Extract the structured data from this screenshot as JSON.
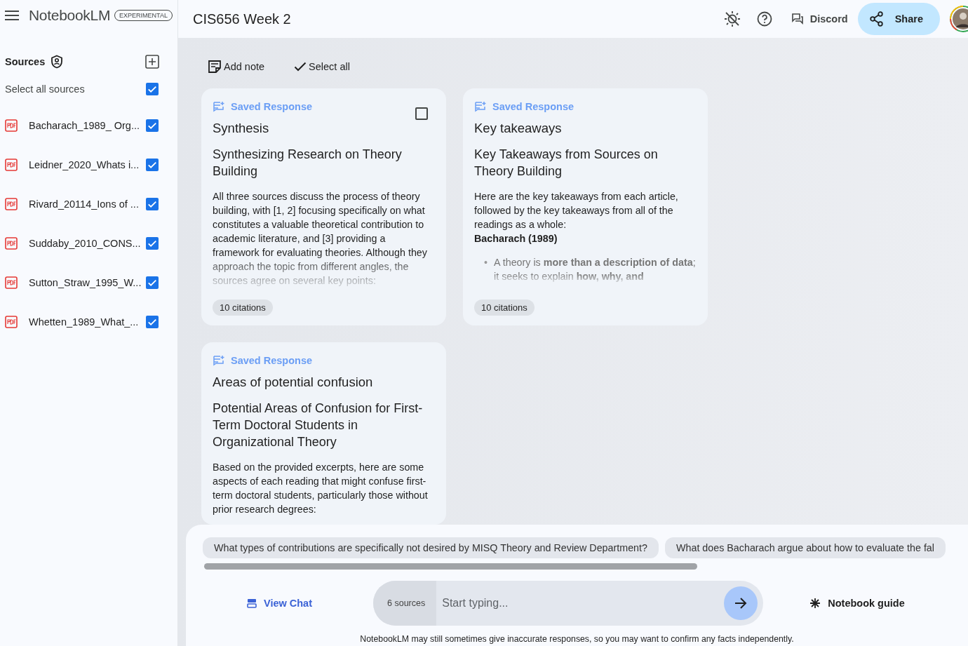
{
  "app": {
    "name": "NotebookLM",
    "badge": "EXPERIMENTAL"
  },
  "notebook_title": "CIS656 Week 2",
  "header_actions": {
    "discord": "Discord",
    "share": "Share"
  },
  "sidebar": {
    "title": "Sources",
    "select_all": {
      "label": "Select all sources",
      "checked": true
    },
    "sources": [
      {
        "name": "Bacharach_1989_ Org...",
        "checked": true
      },
      {
        "name": "Leidner_2020_Whats i...",
        "checked": true
      },
      {
        "name": "Rivard_20114_Ions of ...",
        "checked": true
      },
      {
        "name": "Suddaby_2010_CONS...",
        "checked": true
      },
      {
        "name": "Sutton_Straw_1995_W...",
        "checked": true
      },
      {
        "name": "Whetten_1989_What_...",
        "checked": true
      }
    ]
  },
  "toolbar": {
    "add_note": "Add note",
    "select_all": "Select all"
  },
  "notes": [
    {
      "label": "Saved Response",
      "checked": false,
      "title": "Synthesis",
      "heading": "Synthesizing Research on Theory Building",
      "paragraphs": [
        "All three sources discuss the process of theory building, with [1, 2] focusing specifically on what constitutes a valuable theoretical contribution to academic literature, and [3] providing a framework for evaluating theories. Although they approach the topic from different angles, the sources agree on several key points:"
      ],
      "citations": "10 citations"
    },
    {
      "label": "Saved Response",
      "title": "Key takeaways",
      "heading": "Key Takeaways from Sources on Theory Building",
      "paragraphs": [
        "Here are the key takeaways from each article, followed by the key takeaways from all of the readings as a whole:"
      ],
      "subheading": "Bacharach (1989)",
      "bullets": [
        {
          "marker": "•",
          "text": "A theory is **more than a description of data**; it seeks to explain **how, why, and**"
        }
      ],
      "citations": "10 citations"
    },
    {
      "label": "Saved Response",
      "title": "Areas of potential confusion",
      "heading": "Potential Areas of Confusion for First-Term Doctoral Students in Organizational Theory",
      "paragraphs": [
        "Based on the provided excerpts, here are some aspects of each reading that might confuse first-term doctoral students, particularly those without prior research degrees:"
      ]
    }
  ],
  "suggestions": [
    "What types of contributions are specifically not desired by MISQ Theory and Review Department?",
    "What does Bacharach argue about how to evaluate the fal"
  ],
  "chat": {
    "view_chat": "View Chat",
    "sources_count": "6 sources",
    "placeholder": "Start typing...",
    "guide": "Notebook guide"
  },
  "disclaimer": "NotebookLM may still sometimes give inaccurate responses, so you may want to confirm any facts independently."
}
